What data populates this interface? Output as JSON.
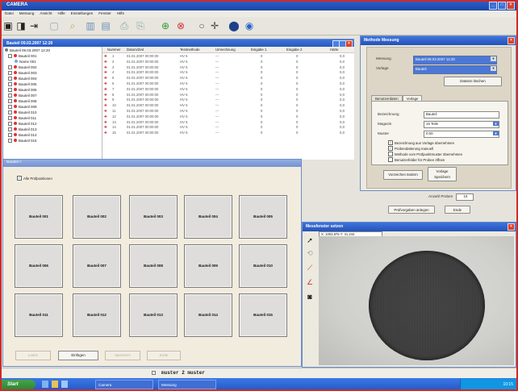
{
  "app": {
    "title": "CAMERA"
  },
  "menu": [
    "Datei",
    "Messung",
    "Ansicht",
    "Hilfe",
    "Einstellungen",
    "Fenster",
    "Hilfe"
  ],
  "toolbar_icons": [
    "monitor-icon",
    "camera-icon",
    "export-icon",
    "new-document-icon",
    "search-icon",
    "chart-icon",
    "report-icon",
    "print-icon",
    "print-setup-icon",
    "add-green-icon",
    "add-red-icon",
    "circle-outline-icon",
    "crosshair-icon",
    "record-icon",
    "globe-icon"
  ],
  "project_window": {
    "title": "Bauteil 09.03.2007 12:20",
    "tree_root": "Bauteil 09.03.2007 12:20",
    "tree_items": [
      "Bauteil 001",
      "Name 001",
      "Bauteil 002",
      "Bauteil 003",
      "Bauteil 004",
      "Bauteil 005",
      "Bauteil 006",
      "Bauteil 007",
      "Bauteil 008",
      "Bauteil 009",
      "Bauteil 010",
      "Bauteil 011",
      "Bauteil 012",
      "Bauteil 013",
      "Bauteil 014",
      "Bauteil 015"
    ],
    "columns": [
      "Nummer",
      "Datum/Zeit",
      "Testmethode",
      "Umrechnung",
      "Eingabe 1",
      "Eingabe 2",
      "Härte"
    ],
    "rows": [
      [
        "1",
        "01.01.2007 00:00:00",
        "HV 5",
        "---",
        "0",
        "0",
        "0,0"
      ],
      [
        "2",
        "01.01.2007 00:00:00",
        "HV 5",
        "---",
        "0",
        "0",
        "0,0"
      ],
      [
        "3",
        "01.01.2007 00:00:00",
        "HV 5",
        "---",
        "0",
        "0",
        "0,0"
      ],
      [
        "4",
        "01.01.2007 00:00:00",
        "HV 5",
        "---",
        "0",
        "0",
        "0,0"
      ],
      [
        "5",
        "01.01.2007 00:00:00",
        "HV 5",
        "---",
        "0",
        "0",
        "0,0"
      ],
      [
        "6",
        "01.01.2007 00:00:00",
        "HV 5",
        "---",
        "0",
        "0",
        "0,0"
      ],
      [
        "7",
        "01.01.2007 00:00:00",
        "HV 5",
        "---",
        "0",
        "0",
        "0,0"
      ],
      [
        "8",
        "01.01.2007 00:00:00",
        "HV 5",
        "---",
        "0",
        "0",
        "0,0"
      ],
      [
        "9",
        "01.01.2007 00:00:00",
        "HV 5",
        "---",
        "0",
        "0",
        "0,0"
      ],
      [
        "10",
        "01.01.2007 00:00:00",
        "HV 5",
        "---",
        "0",
        "0",
        "0,0"
      ],
      [
        "11",
        "01.01.2007 00:00:00",
        "HV 5",
        "---",
        "0",
        "0",
        "0,0"
      ],
      [
        "12",
        "01.01.2007 00:00:00",
        "HV 5",
        "---",
        "0",
        "0",
        "0,0"
      ],
      [
        "13",
        "01.01.2007 00:00:00",
        "HV 5",
        "---",
        "0",
        "0",
        "0,0"
      ],
      [
        "14",
        "01.01.2007 00:00:00",
        "HV 5",
        "---",
        "0",
        "0",
        "0,0"
      ],
      [
        "15",
        "01.01.2007 00:00:00",
        "HV 5",
        "---",
        "0",
        "0",
        "0,0"
      ]
    ]
  },
  "measure_dialog": {
    "title": "Methode Messung",
    "messung_label": "Messung",
    "messung_value": "Bauteil 09.03.2007 12:20",
    "vorlage_label": "Vorlage",
    "vorlage_value": "Bauteil",
    "delete_button": "Dateien löschen",
    "tabs": [
      "Benutzerdaten",
      "Vorlage"
    ],
    "bezeichnung_label": "Bezeichnung",
    "bezeichnung_value": "Bauteil",
    "magazin_label": "Magazin",
    "magazin_value": "15 Teile",
    "muster_label": "Muster",
    "muster_value": "0.00",
    "checkboxes": [
      {
        "label": "Bezeichnung aus Vorlage übernehmen",
        "checked": true
      },
      {
        "label": "Probendatierung manuell",
        "checked": true
      },
      {
        "label": "Methode vom Prüfpunktmuster übernehmen",
        "checked": false
      },
      {
        "label": "Benutzerfelder für Proben öffnen",
        "checked": false
      }
    ],
    "save_as_button": "Vorzeichen ändern",
    "save_template_button": "Vorlage Speichern",
    "count_label": "Anzahl Proben",
    "count_value": "15",
    "create_button": "Prüfvorgaben anlegen",
    "close_button": "Ende"
  },
  "parts_window": {
    "title": "Bauteil",
    "select_all_label": "Alle Prüfpositionen",
    "tiles": [
      "Bauteil 001",
      "Bauteil 002",
      "Bauteil 003",
      "Bauteil 004",
      "Bauteil 005",
      "Bauteil 006",
      "Bauteil 007",
      "Bauteil 008",
      "Bauteil 009",
      "Bauteil 010",
      "Bauteil 011",
      "Bauteil 012",
      "Bauteil 013",
      "Bauteil 014",
      "Bauteil 015"
    ],
    "buttons": [
      {
        "label": "Laden",
        "enabled": false
      },
      {
        "label": "Einfügen",
        "enabled": true
      },
      {
        "label": "Speichern",
        "enabled": false
      },
      {
        "label": "Ende",
        "enabled": false
      }
    ]
  },
  "camera_window": {
    "title": "Messfenster setzen",
    "coords": "X: 1003.876  Y: 41.244",
    "tool_icons": [
      "pointer-icon",
      "measure-icon",
      "line-icon",
      "angle-icon",
      "camera-icon"
    ]
  },
  "status_bar": {
    "text": "muster  2 muster"
  },
  "taskbar": {
    "start": "Start",
    "tasks": [
      "Camera",
      "Messung"
    ],
    "clock": "10:15"
  }
}
